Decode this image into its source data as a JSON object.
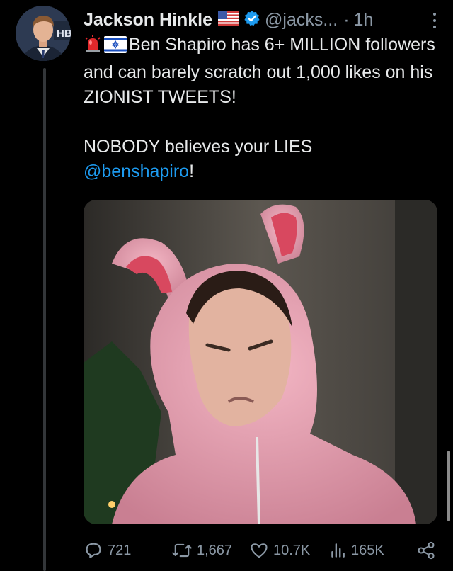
{
  "author": {
    "name": "Jackson Hinkle",
    "handle": "@jacks...",
    "separator": "·",
    "time": "1h",
    "avatar_badge": "HB"
  },
  "tweet": {
    "line1": "Ben Shapiro has 6+ MILLION followers and can barely scratch out 1,000 likes on his ZIONIST TWEETS!",
    "line2_prefix": "NOBODY believes your LIES",
    "mention": "@benshapiro",
    "line2_suffix": "!",
    "emojis": [
      "rotating-light-icon",
      "israel-flag-icon"
    ]
  },
  "actions": {
    "replies": "721",
    "reposts": "1,667",
    "likes": "10.7K",
    "views": "165K"
  },
  "colors": {
    "background": "#000000",
    "text": "#e7e9ea",
    "secondary": "#8b98a5",
    "link": "#1d9bf0",
    "verified": "#1d9bf0"
  }
}
